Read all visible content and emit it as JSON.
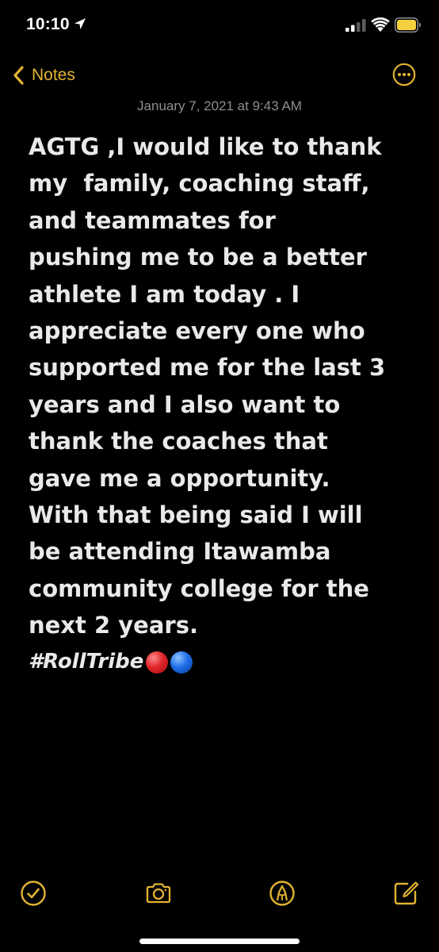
{
  "status_bar": {
    "time": "10:10",
    "location_icon": "location-arrow-icon",
    "signal_icon": "cellular-signal-icon",
    "wifi_icon": "wifi-icon",
    "battery_icon": "battery-icon",
    "battery_color": "#f4d03f"
  },
  "nav": {
    "back_label": "Notes",
    "back_icon": "chevron-left-icon",
    "more_icon": "ellipsis-circle-icon",
    "accent_color": "#e2b232"
  },
  "note": {
    "date": "January 7, 2021 at 9:43 AM",
    "lines": [
      "AGTG ,I would like to thank",
      "my  family, coaching staff,",
      "and teammates for",
      "pushing me to be a better",
      "athlete I am today . I",
      "appreciate every one who",
      "supported me for the last 3",
      "years and I also want to",
      "thank the coaches that",
      "gave me a opportunity.",
      "With that being said I will",
      "be attending Itawamba",
      "community college for the",
      "next 2 years."
    ],
    "hashtag": "#RollTribe",
    "emojis": [
      "red-circle-emoji",
      "blue-circle-emoji"
    ]
  },
  "toolbar": {
    "items": [
      {
        "icon": "checklist-icon"
      },
      {
        "icon": "camera-icon"
      },
      {
        "icon": "markup-pen-icon"
      },
      {
        "icon": "compose-icon"
      }
    ]
  }
}
